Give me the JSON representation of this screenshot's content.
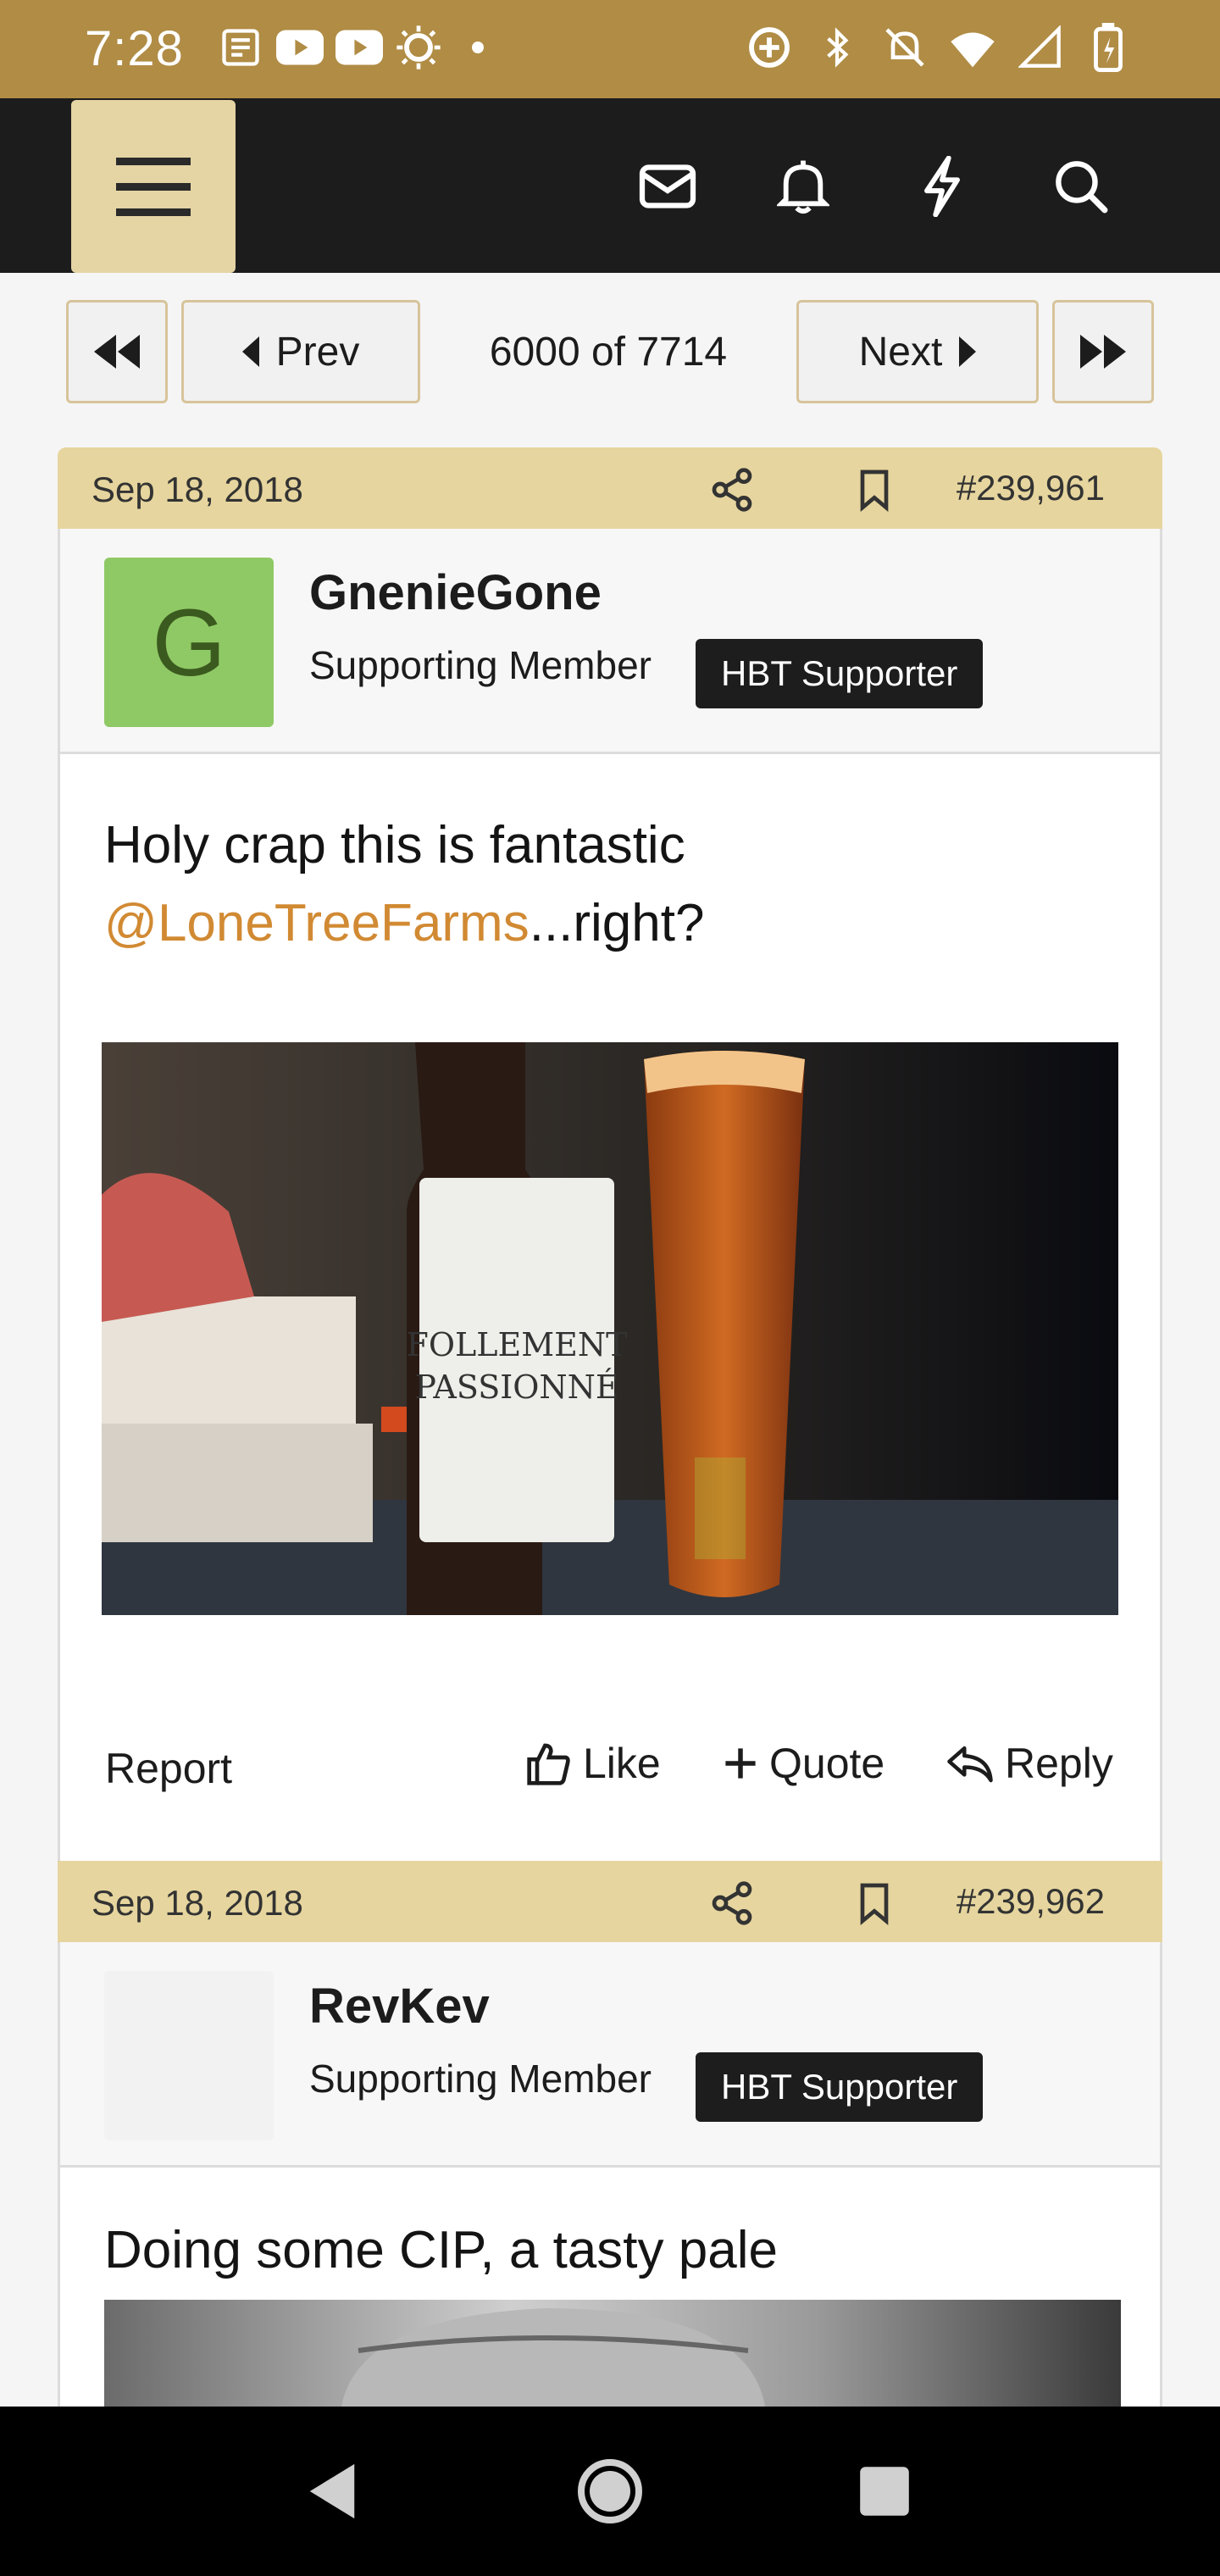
{
  "status_bar": {
    "time": "7:28"
  },
  "header": {
    "icons": [
      "menu-icon",
      "mail-icon",
      "bell-icon",
      "lightning-icon",
      "search-icon"
    ]
  },
  "pager": {
    "prev_label": "Prev",
    "next_label": "Next",
    "position": "6000 of 7714"
  },
  "posts": [
    {
      "date": "Sep 18, 2018",
      "number": "#239,961",
      "avatar_letter": "G",
      "avatar_color": "#8fc965",
      "username": "GnenieGone",
      "user_title": "Supporting Member",
      "badge": "HBT Supporter",
      "message_line1": "Holy crap this is fantastic",
      "mention": "@LoneTreeFarms",
      "message_suffix": "...right?",
      "photo_label": "FOLLEMENT PASSIONNÉ",
      "actions": {
        "report": "Report",
        "like": "Like",
        "quote": "Quote",
        "reply": "Reply"
      }
    },
    {
      "date": "Sep 18, 2018",
      "number": "#239,962",
      "avatar_letter": "",
      "username": "RevKev",
      "user_title": "Supporting Member",
      "badge": "HBT Supporter",
      "message_line1": "Doing some CIP, a tasty pale"
    }
  ],
  "colors": {
    "status_bar": "#b08c45",
    "header": "#1c1c1c",
    "post_header": "#e6d59e",
    "mention": "#d18a33"
  }
}
